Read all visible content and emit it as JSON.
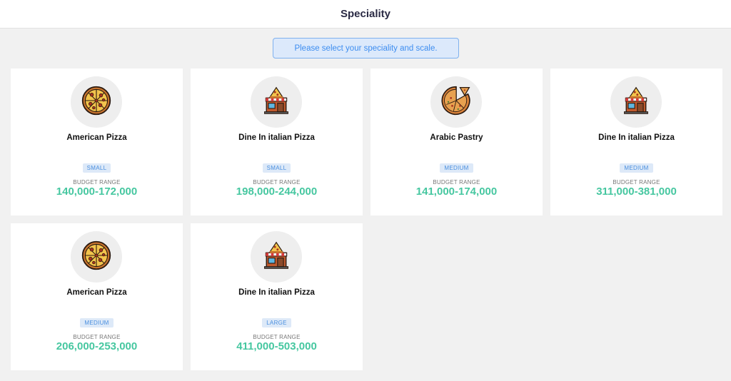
{
  "header": {
    "title": "Speciality"
  },
  "notice": {
    "text": "Please select your speciality and scale."
  },
  "colors": {
    "accent": "#46c7a0",
    "badge_text": "#4a8fdf",
    "notice_text": "#3d8df0"
  },
  "cards": [
    {
      "title": "American Pizza",
      "icon": "pizza-icon",
      "size": "SMALL",
      "budget_label": "BUDGET RANGE",
      "budget": "140,000-172,000"
    },
    {
      "title": "Dine In italian Pizza",
      "icon": "pizzeria-icon",
      "size": "SMALL",
      "budget_label": "BUDGET RANGE",
      "budget": "198,000-244,000"
    },
    {
      "title": "Arabic Pastry",
      "icon": "pastry-icon",
      "size": "MEDIUM",
      "budget_label": "BUDGET RANGE",
      "budget": "141,000-174,000"
    },
    {
      "title": "Dine In italian Pizza",
      "icon": "pizzeria-icon",
      "size": "MEDIUM",
      "budget_label": "BUDGET RANGE",
      "budget": "311,000-381,000"
    },
    {
      "title": "American Pizza",
      "icon": "pizza-icon",
      "size": "MEDIUM",
      "budget_label": "BUDGET RANGE",
      "budget": "206,000-253,000"
    },
    {
      "title": "Dine In italian Pizza",
      "icon": "pizzeria-icon",
      "size": "LARGE",
      "budget_label": "BUDGET RANGE",
      "budget": "411,000-503,000"
    }
  ]
}
